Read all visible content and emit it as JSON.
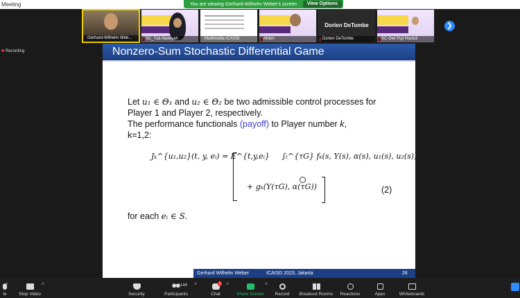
{
  "window": {
    "title": "Meeting"
  },
  "banner": {
    "text": "You are viewing Gerhard-Wilhelm Weber's screen",
    "view_options": "View Options"
  },
  "thumbnails": [
    {
      "name": "Gerhard-Wilhelm Web...",
      "active": true
    },
    {
      "name": "SC_Tuti Alawiyah"
    },
    {
      "name": "Multimedia ICAISD"
    },
    {
      "name": "Ahton"
    },
    {
      "name": "Dorien DeTombe",
      "center_label": "Dorien DeTombe"
    },
    {
      "name": "SC-Dwi Puji Hastuti"
    }
  ],
  "recording": {
    "label": "Recording"
  },
  "slide": {
    "title": "Nonzero-Sum Stochastic Differential Game",
    "line1_pre": "Let ",
    "u1_in": "u₁ ∈ Θ₁",
    "and": " and ",
    "u2_in": "u₂ ∈ Θ₂",
    "line1_post": " be two admissible control processes for",
    "line2": "Player 1 and Player 2, respectively.",
    "line3_pre": "The performance functionals ",
    "payoff": "(payoff)",
    "line3_post": " to Player number ",
    "k": "k",
    "comma": ",",
    "line4": "k=1,2:",
    "formula_lhs": "Jₖ^{u₁,u₂}(t, y, eᵢ) = E^{t,y,eᵢ}",
    "formula_integral": "∫ₜ^{τG} fₖ(s, Y(s), α(s), u₁(s), u₂(s))ds",
    "formula_second": "+ gₖ(Y(τG), α(τG))",
    "eq_number": "(2)",
    "for_each_pre": "for each ",
    "for_each_math": "eᵢ ∈ S.",
    "footer_author": "Gerhard Wilhelm Weber",
    "footer_conf": "ICAISD 2023, Jakarta",
    "footer_page": "26"
  },
  "toolbar": {
    "mute": "te",
    "stop_video": "Stop Video",
    "security": "Security",
    "participants": "Participants",
    "participants_count": "144",
    "chat": "Chat",
    "chat_badge": "1",
    "share_screen": "Share Screen",
    "record": "Record",
    "breakout_rooms": "Breakout Rooms",
    "reactions": "Reactions",
    "apps": "Apps",
    "whiteboards": "Whiteboards"
  },
  "colors": {
    "accent": "#2d8cff",
    "share_green": "#23c16b",
    "banner_green": "#2e9e3f",
    "slide_blue": "#1c3f85",
    "payoff_blue": "#3b3bd0"
  }
}
